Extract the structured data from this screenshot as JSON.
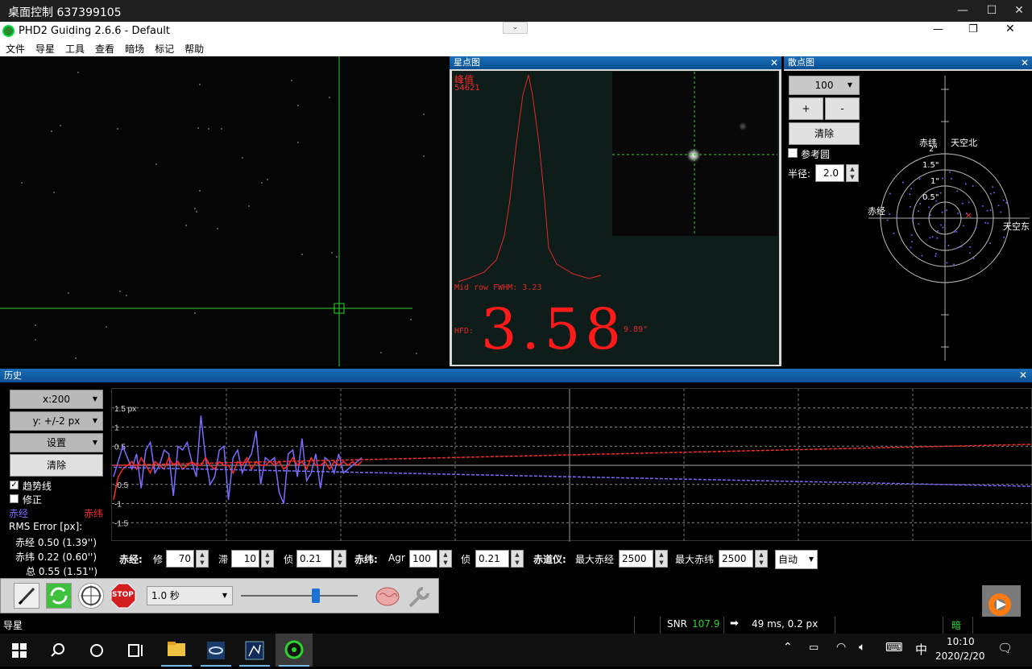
{
  "remote": {
    "title": "桌面控制 637399105",
    "min": "—",
    "max": "☐",
    "close": "✕"
  },
  "app": {
    "title": "PHD2 Guiding 2.6.6 - Default",
    "min": "—",
    "restore": "❐",
    "close": "✕",
    "dropdown": "⌄"
  },
  "menu": [
    "文件",
    "导星",
    "工具",
    "查看",
    "暗场",
    "标记",
    "帮助"
  ],
  "star_profile": {
    "title": "星点图",
    "peak_label": "峰值",
    "peak_value": "54621",
    "fwhm_text": "Mid row FWHM: 3.23",
    "hfd_label": "HFD:",
    "hfd_value": "3.58",
    "hfd_arcsec": "9.89\""
  },
  "scatter": {
    "title": "散点图",
    "zoom_value": "100",
    "plus": "+",
    "minus": "-",
    "clear": "清除",
    "ref_circle": "参考圆",
    "radius_label": "半径:",
    "radius_value": "2.0",
    "labels": {
      "dec": "赤纬",
      "north": "天空北",
      "ra": "赤经",
      "east": "天空东",
      "r2": "2\"",
      "r15": "1.5\"",
      "r1": "1\"",
      "r05": "0.5\""
    }
  },
  "history": {
    "title": "历史",
    "x_scale": "x:200",
    "y_scale": "y: +/-2 px",
    "settings": "设置",
    "clear": "清除",
    "trend": "趋势线",
    "correction": "修正",
    "ra_label": "赤经",
    "dec_label": "赤纬",
    "rms_title": "RMS Error [px]:",
    "rms_ra": "赤经  0.50 (1.39'')",
    "rms_dec": "赤纬  0.22 (0.60'')",
    "rms_tot": "总  0.55 (1.51'')",
    "ylabels": [
      "1.5 px",
      "1",
      "0.5",
      "-0.5",
      "-1",
      "-1.5"
    ],
    "params": {
      "ra_title": "赤经:",
      "hyst_label": "修",
      "hyst_value": "70",
      "agg_label": "滞",
      "agg_value": "10",
      "min_label": "侦",
      "min_value": "0.21",
      "dec_title": "赤纬:",
      "dec_agr_label": "Agr",
      "dec_agr_value": "100",
      "dec_min_label": "侦",
      "dec_min_value": "0.21",
      "mount_title": "赤道仪:",
      "max_ra_label": "最大赤经",
      "max_ra_value": "2500",
      "max_dec_label": "最大赤纬",
      "max_dec_value": "2500",
      "mode_value": "自动"
    }
  },
  "toolbar": {
    "exposure": "1.0 秒",
    "stop": "STOP"
  },
  "status": {
    "left": "导星",
    "snr_label": "SNR",
    "snr_value": "107.9",
    "timing": "49 ms, 0.2 px",
    "dark": "暗"
  },
  "taskbar": {
    "time": "10:10",
    "date": "2020/2/20",
    "ime": "中"
  },
  "colors": {
    "ra": "#7a6cff",
    "dec": "#ff2a2a",
    "accent": "#0a5fa8"
  },
  "chart_data": {
    "type": "line",
    "title": "",
    "ylabel": "px",
    "ylim": [
      -2,
      2
    ],
    "x_points": 200,
    "series": [
      {
        "name": "赤经",
        "values": [
          -0.3,
          0.1,
          0.5,
          0.2,
          -0.1,
          0.3,
          -0.6,
          0.4,
          0.6,
          -0.2,
          0.0,
          0.4,
          0.3,
          -0.8,
          0.5,
          0.4,
          0.6,
          0.1,
          -0.3,
          1.3,
          0.2,
          -0.5,
          -0.3,
          0.4,
          0.5,
          -0.9,
          0.2,
          0.4,
          -0.2,
          0.1,
          0.3,
          0.9,
          -0.5,
          0.2,
          0.1,
          0.2,
          -0.7,
          -1.0,
          0.3,
          0.4,
          -0.3,
          0.7,
          -0.4,
          -0.2,
          0.3,
          -0.6,
          0.2,
          0.1,
          -0.2,
          0.3,
          -0.2,
          -0.1,
          0.0,
          0.1,
          0.2
        ]
      },
      {
        "name": "赤纬",
        "values": [
          -0.9,
          -0.3,
          -0.1,
          0.0,
          0.1,
          -0.1,
          0.2,
          0.0,
          -0.2,
          0.1,
          0.0,
          -0.1,
          0.2,
          0.0,
          0.1,
          -0.1,
          0.0,
          0.1,
          0.0,
          0.0,
          0.2,
          0.0,
          -0.1,
          0.1,
          0.0,
          0.0,
          -0.2,
          0.1,
          0.0,
          0.2,
          -0.1,
          0.1,
          0.0,
          0.0,
          0.1,
          0.0,
          0.1,
          -0.1,
          0.0,
          0.2,
          0.0,
          0.1,
          -0.1,
          0.2,
          0.0,
          0.0,
          0.1,
          -0.1,
          0.1,
          0.0,
          0.1,
          0.0,
          0.1,
          0.0,
          0.1
        ]
      }
    ]
  }
}
